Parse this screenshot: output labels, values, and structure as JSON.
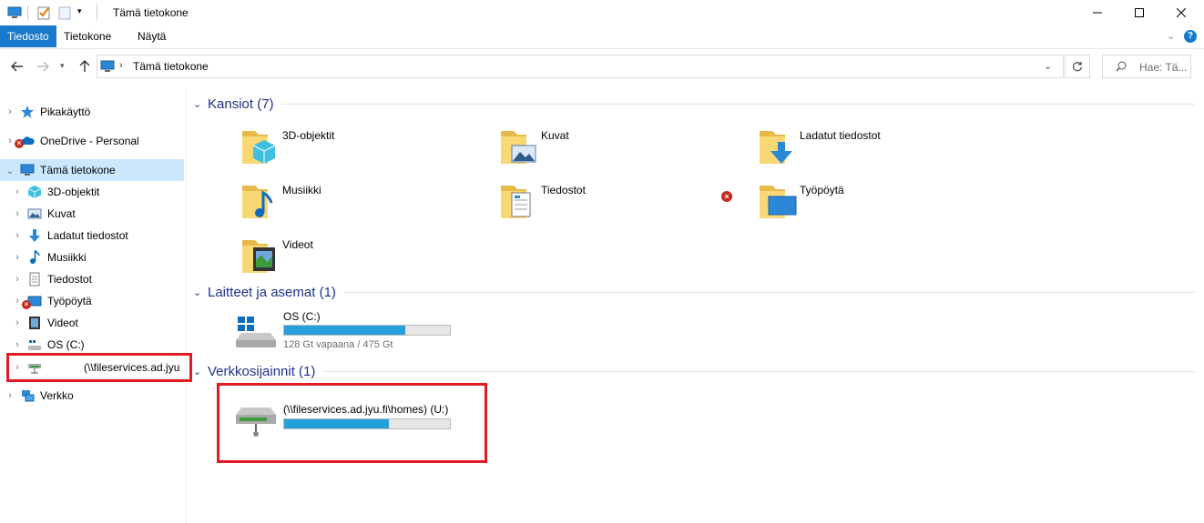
{
  "window": {
    "title": "Tämä tietokone"
  },
  "ribbon": {
    "tabs": [
      "Tiedosto",
      "Tietokone",
      "Näytä"
    ]
  },
  "address": {
    "path": "Tämä tietokone"
  },
  "search": {
    "placeholder": "Hae: Tä..."
  },
  "nav": {
    "items": [
      {
        "label": "Pikakäyttö",
        "icon": "star-icon"
      },
      {
        "label": "OneDrive - Personal",
        "icon": "cloud-icon"
      },
      {
        "label": "Tämä tietokone",
        "icon": "computer-icon",
        "selected": true
      },
      {
        "label": "3D-objektit",
        "icon": "cube-icon"
      },
      {
        "label": "Kuvat",
        "icon": "pictures-icon"
      },
      {
        "label": "Ladatut tiedostot",
        "icon": "download-icon"
      },
      {
        "label": "Musiikki",
        "icon": "music-icon"
      },
      {
        "label": "Tiedostot",
        "icon": "document-icon"
      },
      {
        "label": "Työpöytä",
        "icon": "desktop-icon"
      },
      {
        "label": "Videot",
        "icon": "video-icon"
      },
      {
        "label": "OS (C:)",
        "icon": "drive-icon"
      },
      {
        "label": "(\\\\fileservices.ad.jyu",
        "icon": "network-drive-icon"
      },
      {
        "label": "Verkko",
        "icon": "network-icon"
      }
    ]
  },
  "groups": {
    "folders": {
      "title": "Kansiot (7)"
    },
    "devices": {
      "title": "Laitteet ja asemat (1)"
    },
    "network": {
      "title": "Verkkosijainnit (1)"
    }
  },
  "folders": [
    {
      "label": "3D-objektit"
    },
    {
      "label": "Kuvat"
    },
    {
      "label": "Ladatut tiedostot"
    },
    {
      "label": "Musiikki"
    },
    {
      "label": "Tiedostot"
    },
    {
      "label": "Työpöytä"
    },
    {
      "label": "Videot"
    }
  ],
  "drives": {
    "os": {
      "label": "OS (C:)",
      "free_text": "128 Gt vapaana / 475 Gt",
      "used_fraction": 0.73
    },
    "network": {
      "label": "(\\\\fileservices.ad.jyu.fi\\homes) (U:)",
      "used_fraction": 0.63
    }
  },
  "colors": {
    "accent": "#1979ca",
    "selection": "#cce8ff",
    "group_title": "#1e3287",
    "drive_fill": "#26a0da",
    "highlight": "#e01b24"
  }
}
